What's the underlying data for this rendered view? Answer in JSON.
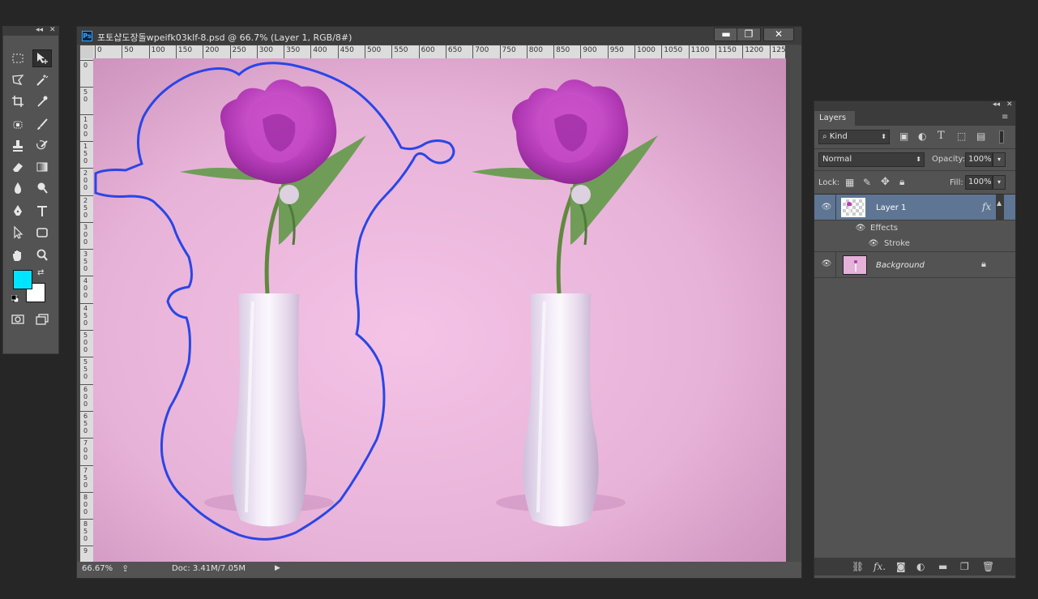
{
  "document": {
    "title": "포토샵도장돌wpeifk03klf-8.psd @ 66.7% (Layer 1, RGB/8#)",
    "ps_label": "Ps",
    "window_buttons": {
      "minimize": "▬",
      "maximize": "❐",
      "close": "✕"
    },
    "ruler_h": [
      "0",
      "50",
      "100",
      "150",
      "200",
      "250",
      "300",
      "350",
      "400",
      "450",
      "500",
      "550",
      "600",
      "650",
      "700",
      "750",
      "800",
      "850",
      "900",
      "950",
      "1000",
      "1050",
      "1100",
      "1150",
      "1200",
      "125"
    ],
    "ruler_v": [
      "0",
      "50",
      "100",
      "150",
      "200",
      "250",
      "300",
      "350",
      "400",
      "450",
      "500",
      "550",
      "600",
      "650",
      "700",
      "750",
      "800",
      "850",
      "9"
    ],
    "status": {
      "zoom": "66.67%",
      "doc_size": "Doc: 3.41M/7.05M"
    }
  },
  "tools": {
    "header_collapse": "◂◂",
    "header_close": "✕",
    "foreground_color": "#00e5ff",
    "background_color": "#ffffff"
  },
  "layers_panel": {
    "tab": "Layers",
    "kind_filter": "Kind",
    "blend_mode": "Normal",
    "opacity_label": "Opacity:",
    "opacity_value": "100%",
    "lock_label": "Lock:",
    "fill_label": "Fill:",
    "fill_value": "100%",
    "layers": [
      {
        "name": "Layer 1",
        "fx": "fx",
        "selected": true
      },
      {
        "name": "Background",
        "italic": true,
        "locked": true
      }
    ],
    "effects_label": "Effects",
    "stroke_label": "Stroke"
  },
  "colors": {
    "stroke": "#2a46e6",
    "canvas_bg": "#e8b6dc",
    "selected_layer": "#5e7694"
  }
}
